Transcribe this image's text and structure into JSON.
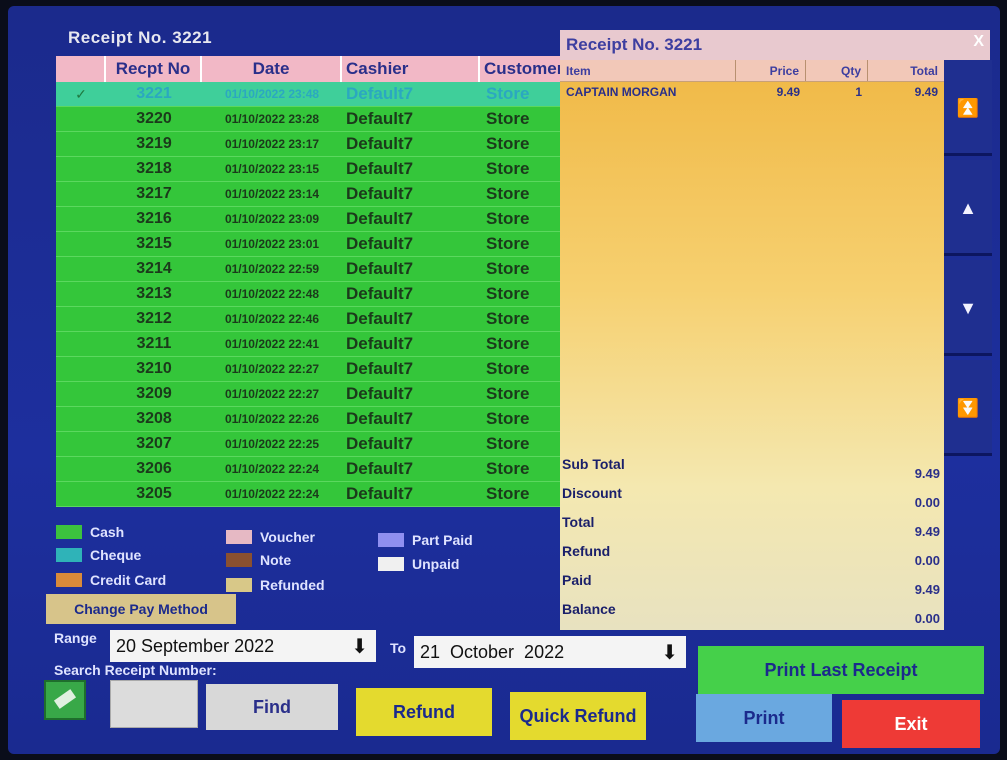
{
  "left_title": "Receipt No. 3221",
  "table": {
    "headers": [
      "Recpt No",
      "Date",
      "Cashier",
      "Customer"
    ],
    "rows": [
      {
        "no": "3221",
        "date": "01/10/2022 23:48",
        "cashier": "Default7",
        "customer": "Store",
        "check": "✓"
      },
      {
        "no": "3220",
        "date": "01/10/2022 23:28",
        "cashier": "Default7",
        "customer": "Store"
      },
      {
        "no": "3219",
        "date": "01/10/2022 23:17",
        "cashier": "Default7",
        "customer": "Store"
      },
      {
        "no": "3218",
        "date": "01/10/2022 23:15",
        "cashier": "Default7",
        "customer": "Store"
      },
      {
        "no": "3217",
        "date": "01/10/2022 23:14",
        "cashier": "Default7",
        "customer": "Store"
      },
      {
        "no": "3216",
        "date": "01/10/2022 23:09",
        "cashier": "Default7",
        "customer": "Store"
      },
      {
        "no": "3215",
        "date": "01/10/2022 23:01",
        "cashier": "Default7",
        "customer": "Store"
      },
      {
        "no": "3214",
        "date": "01/10/2022 22:59",
        "cashier": "Default7",
        "customer": "Store"
      },
      {
        "no": "3213",
        "date": "01/10/2022 22:48",
        "cashier": "Default7",
        "customer": "Store"
      },
      {
        "no": "3212",
        "date": "01/10/2022 22:46",
        "cashier": "Default7",
        "customer": "Store"
      },
      {
        "no": "3211",
        "date": "01/10/2022 22:41",
        "cashier": "Default7",
        "customer": "Store"
      },
      {
        "no": "3210",
        "date": "01/10/2022 22:27",
        "cashier": "Default7",
        "customer": "Store"
      },
      {
        "no": "3209",
        "date": "01/10/2022 22:27",
        "cashier": "Default7",
        "customer": "Store"
      },
      {
        "no": "3208",
        "date": "01/10/2022 22:26",
        "cashier": "Default7",
        "customer": "Store"
      },
      {
        "no": "3207",
        "date": "01/10/2022 22:25",
        "cashier": "Default7",
        "customer": "Store"
      },
      {
        "no": "3206",
        "date": "01/10/2022 22:24",
        "cashier": "Default7",
        "customer": "Store"
      },
      {
        "no": "3205",
        "date": "01/10/2022 22:24",
        "cashier": "Default7",
        "customer": "Store"
      }
    ]
  },
  "legend": {
    "cash": "Cash",
    "cheque": "Cheque",
    "credit_card": "Credit Card",
    "voucher": "Voucher",
    "note": "Note",
    "refunded": "Refunded",
    "part_paid": "Part Paid",
    "unpaid": "Unpaid"
  },
  "legend_colors": {
    "cash": "#3cc23e",
    "cheque": "#2fb3b8",
    "credit_card": "#d98a3a",
    "voucher": "#e6b9c4",
    "note": "#8a5030",
    "refunded": "#d8c888",
    "part_paid": "#8f8ff0",
    "unpaid": "#f0f0f0"
  },
  "change_pay_method": "Change Pay Method",
  "right_title": "Receipt No. 3221",
  "close_label": "X",
  "items": {
    "headers": [
      "Item",
      "Price",
      "Qty",
      "Total"
    ],
    "rows": [
      {
        "item": "CAPTAIN MORGAN",
        "price": "9.49",
        "qty": "1",
        "total": "9.49"
      }
    ]
  },
  "totals": {
    "sub_total_label": "Sub Total",
    "sub_total": "9.49",
    "discount_label": "Discount",
    "discount": "0.00",
    "total_label": "Total",
    "total": "9.49",
    "refund_label": "Refund",
    "refund": "0.00",
    "paid_label": "Paid",
    "paid": "9.49",
    "balance_label": "Balance",
    "balance": "0.00"
  },
  "range_label": "Range",
  "from_date": "20 September 2022",
  "to_label": "To",
  "to_date": "21  October  2022",
  "search_label": "Search Receipt Number:",
  "buttons": {
    "find": "Find",
    "refund": "Refund",
    "quick_refund": "Quick Refund",
    "print_last": "Print Last Receipt",
    "print": "Print",
    "exit": "Exit"
  }
}
